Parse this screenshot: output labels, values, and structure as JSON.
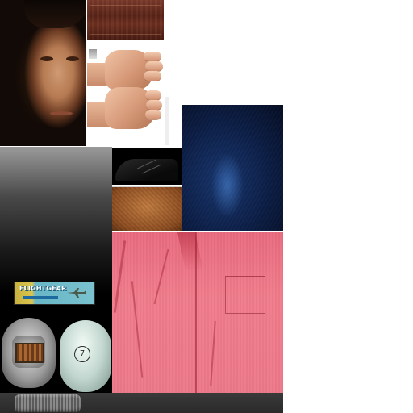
{
  "label": {
    "title": "FLIGHTGEAR",
    "icon": "airplane-icon"
  },
  "helmet": {
    "logo_text": "7"
  },
  "colors": {
    "shirt": "#ec7889",
    "jeans": "#0b1d44",
    "wallet": "#8a4a1e",
    "belt": "#5a2418",
    "label_gold": "#d9c452",
    "label_blue": "#7ac2cf"
  }
}
